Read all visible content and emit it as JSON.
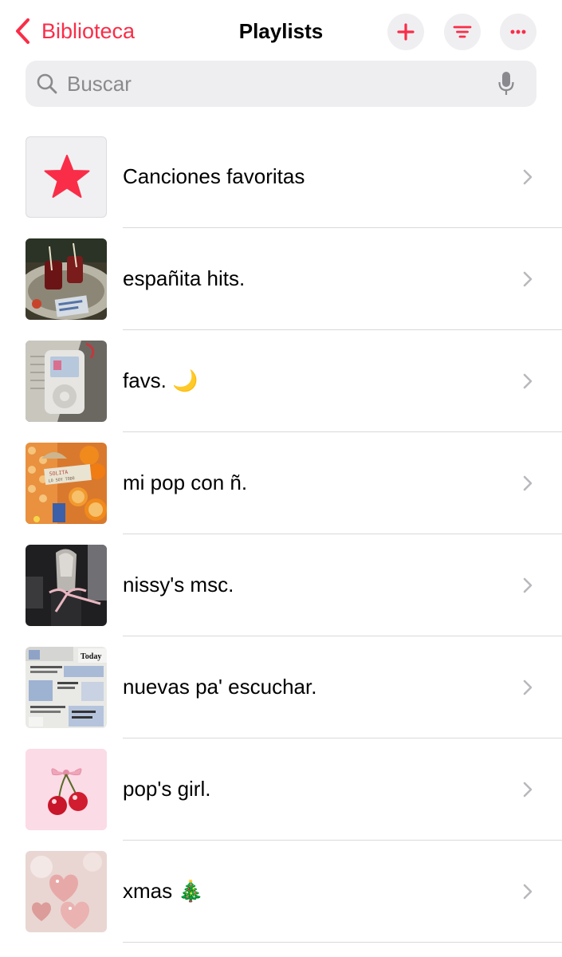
{
  "header": {
    "back_label": "Biblioteca",
    "title": "Playlists"
  },
  "search": {
    "placeholder": "Buscar"
  },
  "playlists": [
    {
      "label": "Canciones favoritas"
    },
    {
      "label": "españita hits."
    },
    {
      "label": "favs. 🌙"
    },
    {
      "label": "mi pop con ñ."
    },
    {
      "label": "nissy's msc."
    },
    {
      "label": "nuevas pa' escuchar."
    },
    {
      "label": "pop's girl."
    },
    {
      "label": "xmas 🎄"
    }
  ],
  "thumb_texts": {
    "orange_sign": "SOLITA LO SOY TODO",
    "newspaper_word": "Today"
  },
  "colors": {
    "accent": "#fa2d48",
    "button_bg": "#efeff2",
    "search_bg": "#eeeef0"
  },
  "icons": {
    "back": "chevron-left-icon",
    "add": "plus-icon",
    "sort": "sort-lines-icon",
    "more": "ellipsis-icon",
    "search": "magnifier-icon",
    "mic": "microphone-icon",
    "favorites": "star-icon",
    "row_chevron": "chevron-right-icon"
  }
}
